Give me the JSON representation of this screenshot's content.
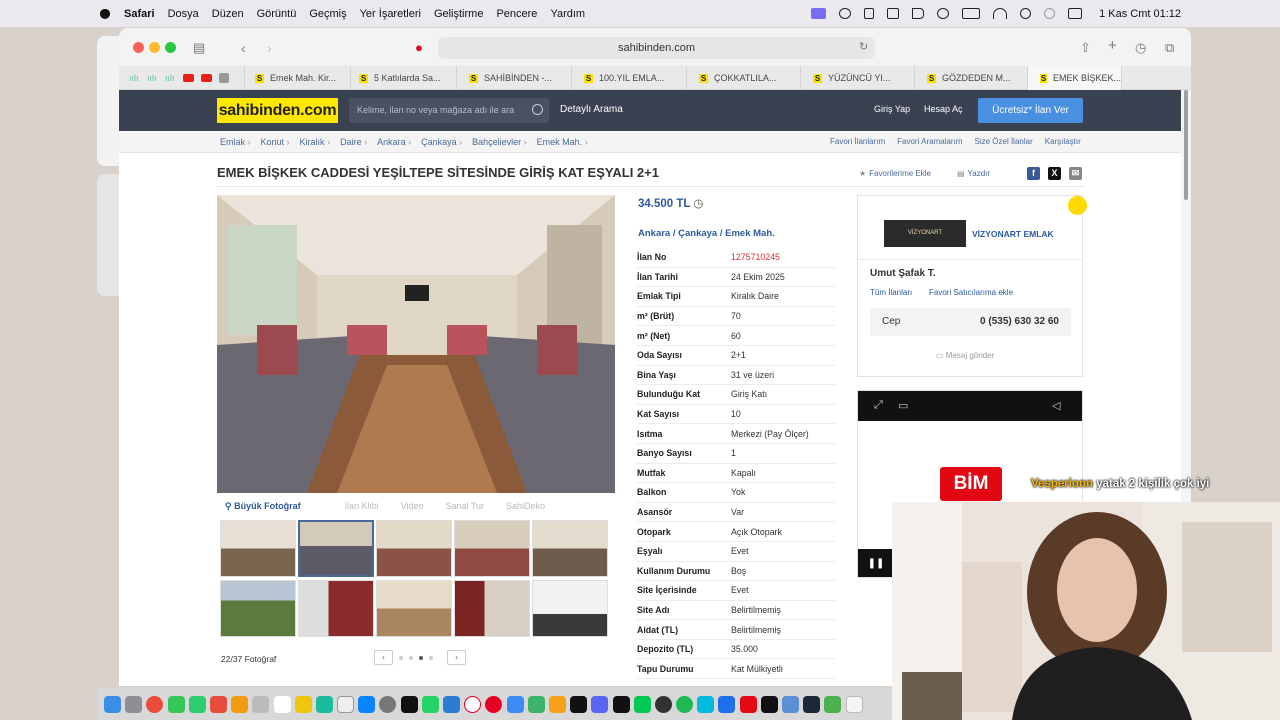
{
  "menubar": {
    "app": "Safari",
    "items": [
      "Dosya",
      "Düzen",
      "Görüntü",
      "Geçmiş",
      "Yer İşaretleri",
      "Geliştirme",
      "Pencere",
      "Yardım"
    ],
    "clock": "1 Kas Cmt  01:12"
  },
  "browser": {
    "url": "sahibinden.com",
    "tabs": [
      "Emek Mah. Kir...",
      "5 Katlılarda Sa...",
      "SAHİBİNDEN -...",
      "100.YIL EMLA...",
      "ÇOKKATLILA...",
      "YÜZÜNCÜ YI...",
      "GÖZDEDEN M...",
      "EMEK BİŞKEK..."
    ]
  },
  "site": {
    "logo": "sahibinden.com",
    "search_placeholder": "Kelime, ilan no veya mağaza adı ile ara",
    "detailed_search": "Detaylı Arama",
    "login": "Giriş Yap",
    "register": "Hesap Aç",
    "post_ad": "Ücretsiz* İlan Ver",
    "breadcrumbs": [
      "Emlak",
      "Konut",
      "Kiralık",
      "Daire",
      "Ankara",
      "Çankaya",
      "Bahçelievler",
      "Emek Mah."
    ],
    "fav_links": [
      "Favori İlanlarım",
      "Favori Aramalarım",
      "Size Özel İlanlar",
      "Karşılaştır"
    ]
  },
  "listing": {
    "title": "EMEK BİŞKEK CADDESİ YEŞİLTEPE SİTESİNDE GİRİŞ KAT EŞYALI 2+1",
    "add_favorite": "Favorilerime Ekle",
    "print": "Yazdır",
    "price": "34.500 TL",
    "location": "Ankara  /  Çankaya  /  Emek Mah.",
    "photo_tabs": [
      "Büyük Fotoğraf",
      "İlan Klibi",
      "Video",
      "Sanal Tur",
      "SahiDeko"
    ],
    "photo_count": "22/37 Fotoğraf",
    "specs": [
      {
        "k": "İlan No",
        "v": "1275710245"
      },
      {
        "k": "İlan Tarihi",
        "v": "24 Ekim 2025"
      },
      {
        "k": "Emlak Tipi",
        "v": "Kiralık Daire"
      },
      {
        "k": "m² (Brüt)",
        "v": "70"
      },
      {
        "k": "m² (Net)",
        "v": "60"
      },
      {
        "k": "Oda Sayısı",
        "v": "2+1"
      },
      {
        "k": "Bina Yaşı",
        "v": "31 ve üzeri"
      },
      {
        "k": "Bulunduğu Kat",
        "v": "Giriş Katı"
      },
      {
        "k": "Kat Sayısı",
        "v": "10"
      },
      {
        "k": "Isıtma",
        "v": "Merkezi (Pay Ölçer)"
      },
      {
        "k": "Banyo Sayısı",
        "v": "1"
      },
      {
        "k": "Mutfak",
        "v": "Kapalı"
      },
      {
        "k": "Balkon",
        "v": "Yok"
      },
      {
        "k": "Asansör",
        "v": "Var"
      },
      {
        "k": "Otopark",
        "v": "Açık Otopark"
      },
      {
        "k": "Eşyalı",
        "v": "Evet"
      },
      {
        "k": "Kullanım Durumu",
        "v": "Boş"
      },
      {
        "k": "Site İçerisinde",
        "v": "Evet"
      },
      {
        "k": "Site Adı",
        "v": "Belirtilmemiş"
      },
      {
        "k": "Aidat (TL)",
        "v": "Belirtilmemiş"
      },
      {
        "k": "Depozito (TL)",
        "v": "35.000"
      },
      {
        "k": "Tapu Durumu",
        "v": "Kat Mülkiyetli"
      }
    ]
  },
  "seller": {
    "logo_text": "VİZYONART",
    "agency": "VİZYONART EMLAK",
    "name": "Umut Şafak T.",
    "all_ads": "Tüm İlanları",
    "fav_seller": "Favori Satıcılarıma ekle",
    "phone_label": "Cep",
    "phone": "0 (535) 630 32 60",
    "message": "Mesaj gönder"
  },
  "ad": {
    "brand": "BİM"
  },
  "stream_overlay": {
    "user": "Vesperionn",
    "text": "yatak 2 kişilik çok iyi"
  },
  "colors": {
    "accent_blue": "#2d5aa0",
    "logo_yellow": "#ffe800",
    "header_bg": "#3a4150",
    "cta_blue": "#4a90e2"
  }
}
